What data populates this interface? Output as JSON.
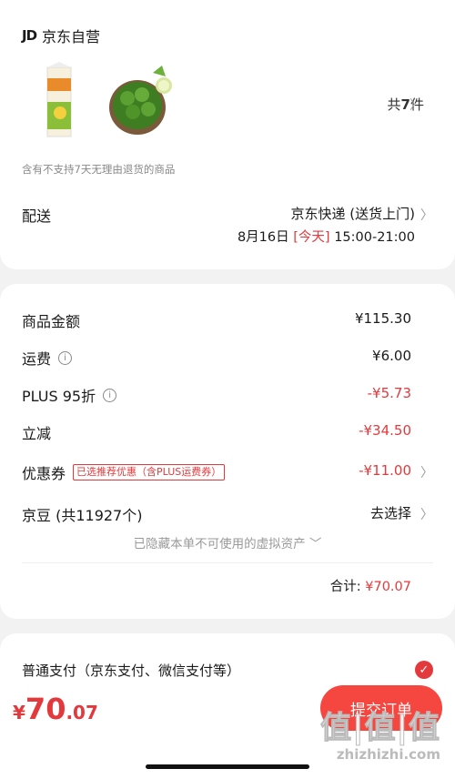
{
  "store": {
    "logo": "JD",
    "name": "京东自营"
  },
  "products": {
    "count_prefix": "共",
    "count": "7",
    "count_suffix": "件"
  },
  "notice": "含有不支持7天无理由退货的商品",
  "shipping": {
    "label": "配送",
    "method": "京东快递 (送货上门)",
    "date": "8月16日",
    "today": "[今天]",
    "time": "15:00-21:00"
  },
  "summary": {
    "goods_amount": {
      "label": "商品金额",
      "value": "¥115.30"
    },
    "freight": {
      "label": "运费",
      "value": "¥6.00"
    },
    "plus_discount": {
      "label": "PLUS 95折",
      "value": "-¥5.73"
    },
    "instant_off": {
      "label": "立减",
      "value": "-¥34.50"
    },
    "coupon": {
      "label": "优惠券",
      "tag": "已选推荐优惠（含PLUS运费券）",
      "value": "-¥11.00"
    },
    "jd_beans": {
      "label": "京豆 (共11927个)",
      "value": "去选择"
    },
    "hidden_note": "已隐藏本单不可使用的虚拟资产",
    "total_label": "合计:",
    "total_value": "¥70.07"
  },
  "payment": {
    "label": "普通支付（京东支付、微信支付等）"
  },
  "bottom": {
    "currency": "¥",
    "price_int": "70",
    "price_dec": ".07",
    "submit_label": "提交订单"
  },
  "watermark": {
    "logo": "值|值|值",
    "url": "zhizhizhi.com"
  },
  "colors": {
    "accent": "#e4393c",
    "background": "#f2f2f2"
  }
}
